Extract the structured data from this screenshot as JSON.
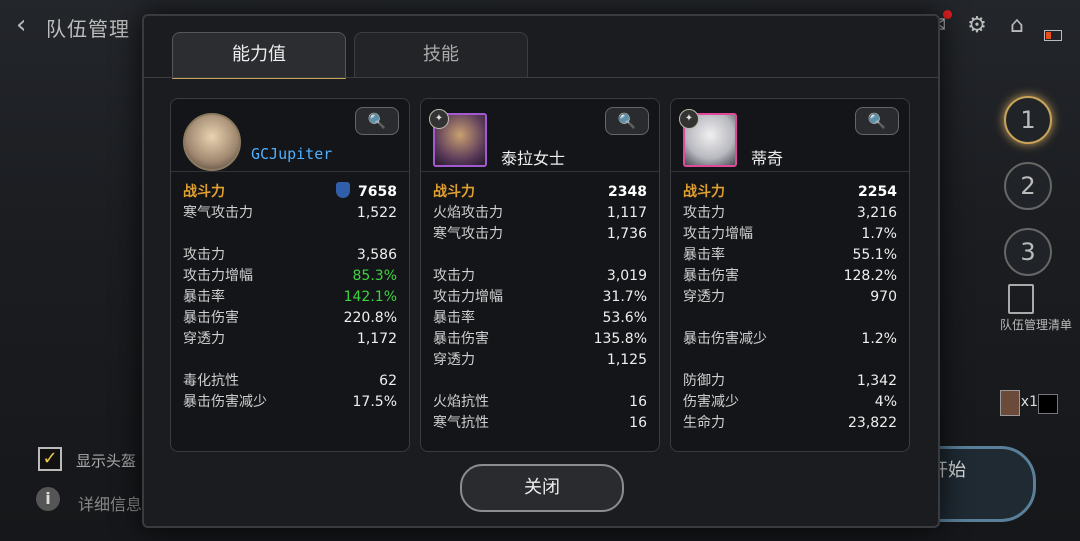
{
  "header": {
    "back_label": "‹",
    "title": "队伍管理"
  },
  "side": {
    "slots": [
      "1",
      "2",
      "3"
    ],
    "team_list_label": "队伍管理清单",
    "item_count": "x1",
    "show_helmet_label": "显示头盔",
    "detail_info_label": "详细信息",
    "start_label": "开始"
  },
  "dialog": {
    "tabs": [
      "能力值",
      "技能"
    ],
    "close_label": "关闭",
    "characters": [
      {
        "name": "GCJupiter",
        "power_label": "战斗力",
        "power": "7658",
        "groups": [
          [
            [
              "寒气攻击力",
              "1,522"
            ]
          ],
          [
            [
              "攻击力",
              "3,586"
            ],
            [
              "攻击力增幅",
              "85.3%"
            ],
            [
              "暴击率",
              "142.1%"
            ],
            [
              "暴击伤害",
              "220.8%"
            ],
            [
              "穿透力",
              "1,172"
            ]
          ],
          [
            [
              "毒化抗性",
              "62"
            ],
            [
              "暴击伤害减少",
              "17.5%"
            ]
          ]
        ]
      },
      {
        "name": "泰拉女士",
        "power_label": "战斗力",
        "power": "2348",
        "groups": [
          [
            [
              "火焰攻击力",
              "1,117"
            ],
            [
              "寒气攻击力",
              "1,736"
            ]
          ],
          [
            [
              "攻击力",
              "3,019"
            ],
            [
              "攻击力增幅",
              "31.7%"
            ],
            [
              "暴击率",
              "53.6%"
            ],
            [
              "暴击伤害",
              "135.8%"
            ],
            [
              "穿透力",
              "1,125"
            ]
          ],
          [
            [
              "火焰抗性",
              "16"
            ],
            [
              "寒气抗性",
              "16"
            ]
          ]
        ]
      },
      {
        "name": "蒂奇",
        "power_label": "战斗力",
        "power": "2254",
        "groups": [
          [
            [
              "攻击力",
              "3,216"
            ],
            [
              "攻击力增幅",
              "1.7%"
            ],
            [
              "暴击率",
              "55.1%"
            ],
            [
              "暴击伤害",
              "128.2%"
            ],
            [
              "穿透力",
              "970"
            ]
          ],
          [
            [
              "暴击伤害减少",
              "1.2%"
            ]
          ],
          [
            [
              "防御力",
              "1,342"
            ],
            [
              "伤害减少",
              "4%"
            ],
            [
              "生命力",
              "23,822"
            ]
          ]
        ]
      }
    ]
  }
}
